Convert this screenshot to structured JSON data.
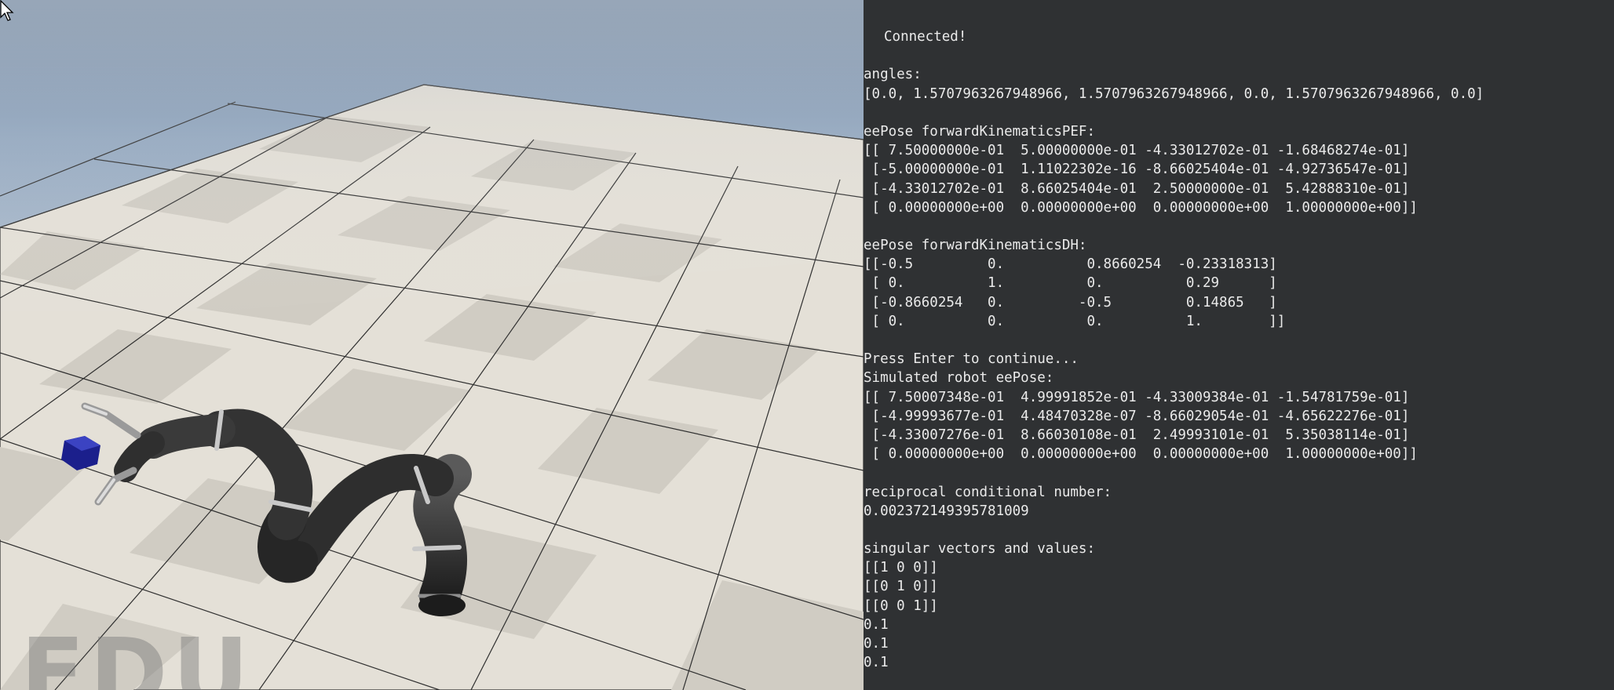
{
  "simulator": {
    "watermark_text": "EDU",
    "floor_color_light": "#e8e4dc",
    "floor_color_dark": "#d3cfc6",
    "object_color": "#1b1f8c",
    "robot_color": "#3a3a3a"
  },
  "terminal": {
    "connected": "Connected!",
    "lines": [
      "",
      "angles:",
      "[0.0, 1.5707963267948966, 1.5707963267948966, 0.0, 1.5707963267948966, 0.0]",
      "",
      "eePose forwardKinematicsPEF:",
      "[[ 7.50000000e-01  5.00000000e-01 -4.33012702e-01 -1.68468274e-01]",
      " [-5.00000000e-01  1.11022302e-16 -8.66025404e-01 -4.92736547e-01]",
      " [-4.33012702e-01  8.66025404e-01  2.50000000e-01  5.42888310e-01]",
      " [ 0.00000000e+00  0.00000000e+00  0.00000000e+00  1.00000000e+00]]",
      "",
      "eePose forwardKinematicsDH:",
      "[[-0.5         0.          0.8660254  -0.23318313]",
      " [ 0.          1.          0.          0.29      ]",
      " [-0.8660254   0.         -0.5         0.14865   ]",
      " [ 0.          0.          0.          1.        ]]",
      "",
      "Press Enter to continue...",
      "Simulated robot eePose:",
      "[[ 7.50007348e-01  4.99991852e-01 -4.33009384e-01 -1.54781759e-01]",
      " [-4.99993677e-01  4.48470328e-07 -8.66029054e-01 -4.65622276e-01]",
      " [-4.33007276e-01  8.66030108e-01  2.49993101e-01  5.35038114e-01]",
      " [ 0.00000000e+00  0.00000000e+00  0.00000000e+00  1.00000000e+00]]",
      "",
      "reciprocal conditional number:",
      "0.002372149395781009",
      "",
      "singular vectors and values:",
      "[[1 0 0]]",
      "[[0 1 0]]",
      "[[0 0 1]]",
      "0.1",
      "0.1",
      "0.1"
    ]
  }
}
